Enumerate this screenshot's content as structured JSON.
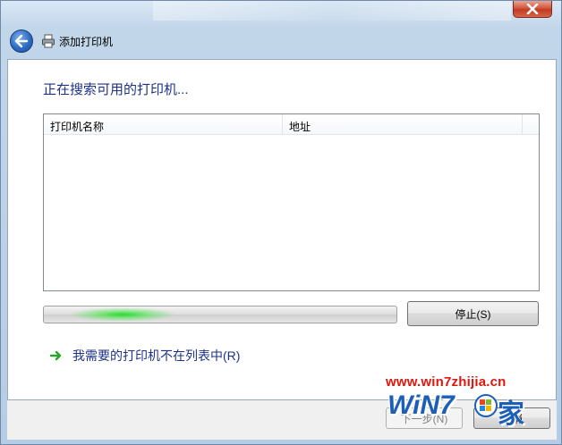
{
  "window": {
    "title": "添加打印机",
    "close_label": "×"
  },
  "main": {
    "heading": "正在搜索可用的打印机...",
    "list": {
      "columns": [
        "打印机名称",
        "地址"
      ],
      "rows": []
    },
    "progress_label": "searching (indeterminate)",
    "stop_button": "停止(S)",
    "not_listed_link": "我需要的打印机不在列表中(R)"
  },
  "footer": {
    "next_button": "下一步(N)",
    "cancel_button": "取消"
  },
  "watermark": {
    "url": "www.win7zhijia.cn",
    "logo_text": "WiN7",
    "logo_suffix": "家"
  },
  "colors": {
    "heading": "#1e3287",
    "link": "#1e3287",
    "watermark_red": "#e1150c",
    "watermark_blue": "#1d5fb7"
  },
  "icons": {
    "back": "back-arrow-icon",
    "printer": "printer-icon",
    "link_arrow": "green-arrow-icon",
    "close": "close-icon"
  }
}
